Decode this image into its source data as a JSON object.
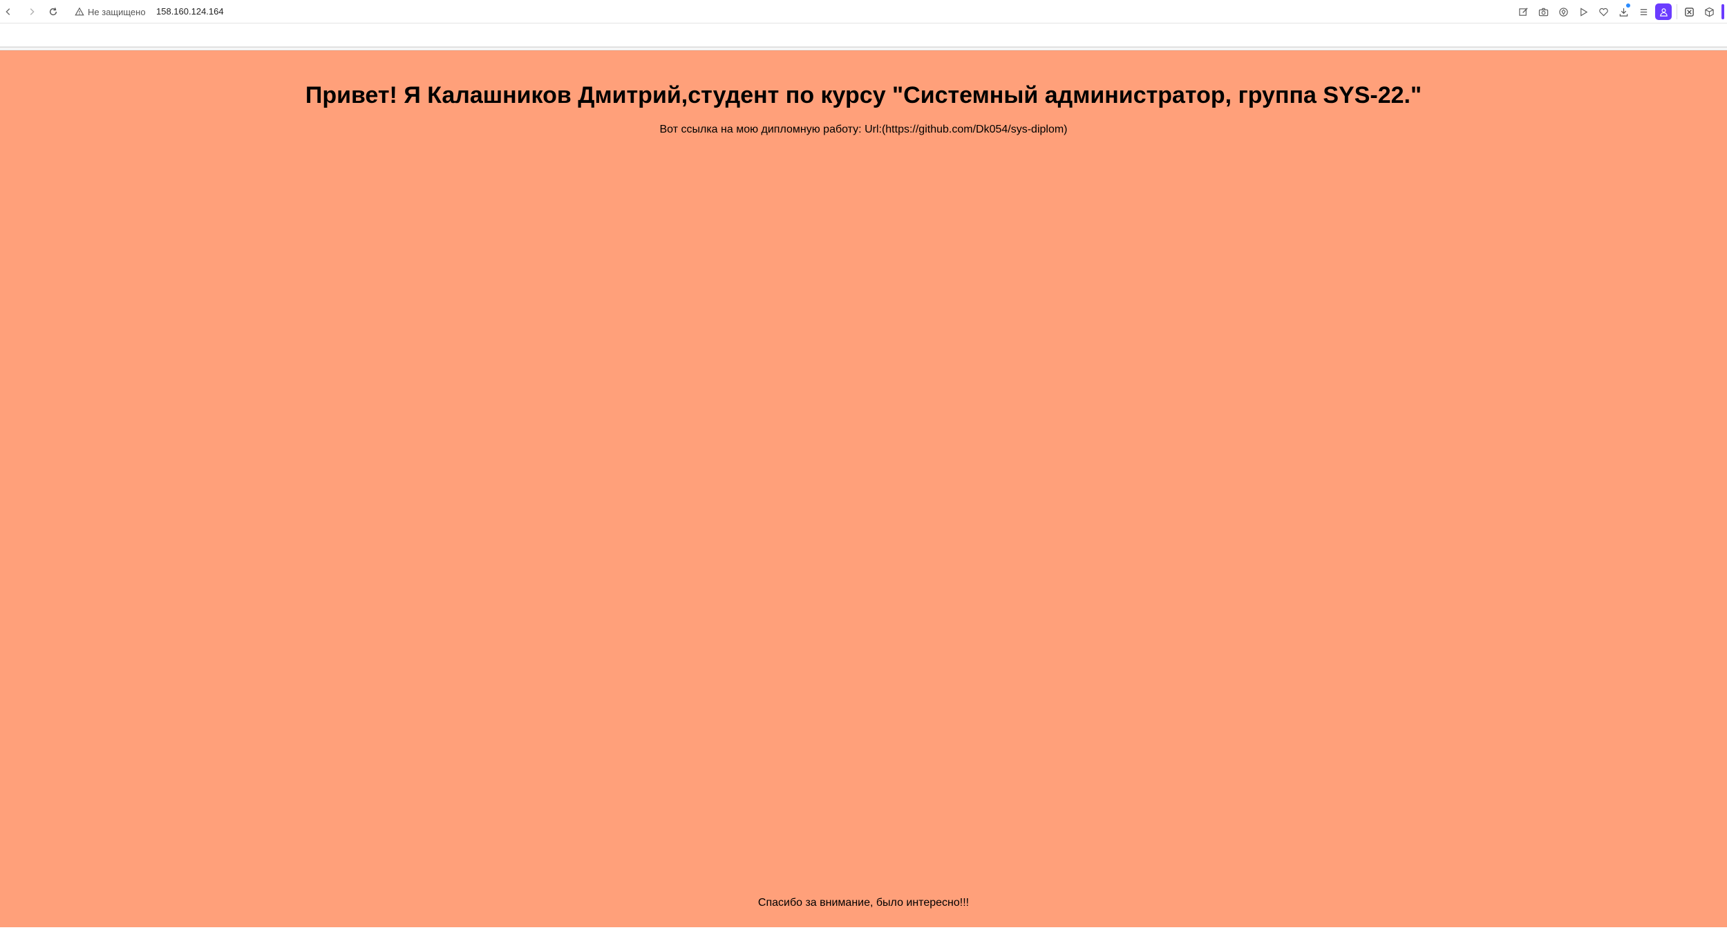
{
  "browser": {
    "security_label": "Не защищено",
    "url": "158.160.124.164",
    "icons": [
      "back-icon",
      "forward-icon",
      "reload-icon",
      "warning-icon",
      "edit-icon",
      "camera-icon",
      "shield-icon",
      "play-icon",
      "heart-icon",
      "download-icon",
      "menu-icon",
      "profile-icon",
      "extensions-icon",
      "cube-icon"
    ],
    "accent_color": "#6b3cff"
  },
  "page": {
    "background_color": "#ffa07a",
    "title": "Привет! Я Калашников Дмитрий,студент по курсу \"Системный администратор, группа SYS-22.\"",
    "link_text": "Вот ссылка на мою дипломную работу: Url:(https://github.com/Dk054/sys-diplom)",
    "footer_text": "Спасибо за внимание, было интересно!!!"
  }
}
